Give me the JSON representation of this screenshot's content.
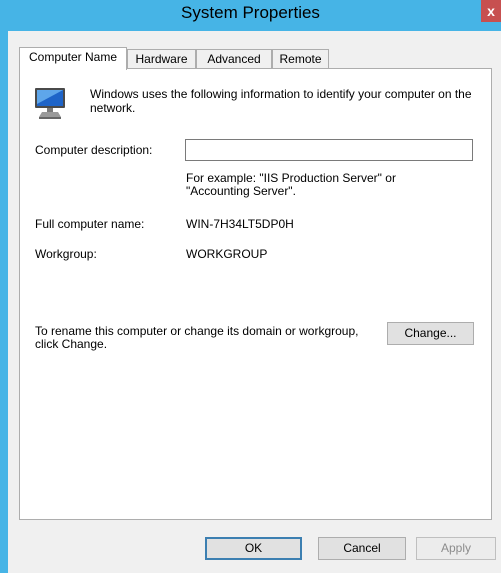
{
  "window": {
    "title": "System Properties",
    "close_label": "x"
  },
  "tabs": [
    {
      "label": "Computer Name",
      "active": true
    },
    {
      "label": "Hardware",
      "active": false
    },
    {
      "label": "Advanced",
      "active": false
    },
    {
      "label": "Remote",
      "active": false
    }
  ],
  "computer_name": {
    "intro": "Windows uses the following information to identify your computer on the network.",
    "description_label": "Computer description:",
    "description_value": "",
    "example": "For example: \"IIS Production Server\" or \"Accounting Server\".",
    "full_name_label": "Full computer name:",
    "full_name_value": "WIN-7H34LT5DP0H",
    "workgroup_label": "Workgroup:",
    "workgroup_value": "WORKGROUP",
    "rename_text": "To rename this computer or change its domain or workgroup, click Change.",
    "change_button": "Change..."
  },
  "footer": {
    "ok": "OK",
    "cancel": "Cancel",
    "apply": "Apply"
  },
  "icons": {
    "computer": "computer-icon",
    "close": "close-icon"
  },
  "colors": {
    "titlebar": "#46b4e6",
    "close_button": "#c75050",
    "dialog_background": "#f0f0f0"
  }
}
